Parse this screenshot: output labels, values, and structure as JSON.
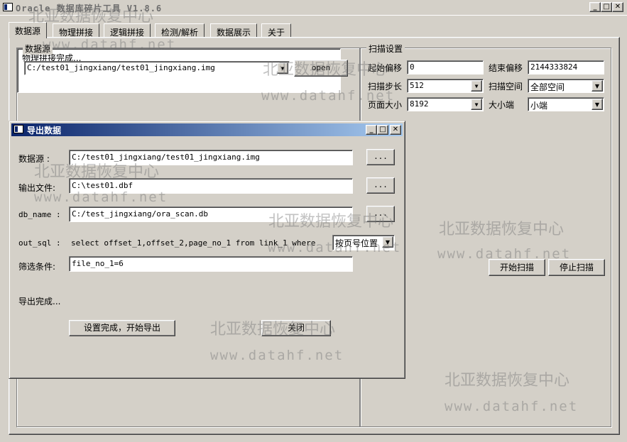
{
  "window": {
    "title": "Oracle 数据库碎片工具  V1.8.6",
    "buttons": {
      "minimize": "_",
      "maximize": "□",
      "close": "✕"
    }
  },
  "tabs": [
    {
      "label": "数据源"
    },
    {
      "label": "物理拼接"
    },
    {
      "label": "逻辑拼接"
    },
    {
      "label": "检测/解析"
    },
    {
      "label": "数据展示"
    },
    {
      "label": "关于"
    }
  ],
  "datasource": {
    "group_title": "数据源",
    "path": "C:/test01_jingxiang/test01_jingxiang.img",
    "open_label": "open"
  },
  "scan": {
    "group_title": "扫描设置",
    "start_offset_label": "起始偏移",
    "start_offset": "0",
    "end_offset_label": "结束偏移",
    "end_offset": "2144333824",
    "step_label": "扫描步长",
    "step": "512",
    "space_label": "扫描空间",
    "space": "全部空间",
    "page_size_label": "页面大小",
    "page_size": "8192",
    "endian_label": "大小端",
    "endian": "小端",
    "start_button": "开始扫描",
    "stop_button": "停止扫描"
  },
  "log": {
    "text": "物理拼接完成..."
  },
  "dialog": {
    "title": "导出数据",
    "datasource_label": "数据源  :",
    "datasource_value": "C:/test01_jingxiang/test01_jingxiang.img",
    "output_label": "输出文件:",
    "output_value": "C:\\test01.dbf",
    "dbname_label": "db_name  :",
    "dbname_value": "C:/test_jingxiang/ora_scan.db",
    "browse_label": "...",
    "sql_label": "out_sql  :",
    "sql_value": "select offset_1,offset_2,page_no_1 from link_1 where",
    "sort_value": "按页号位置",
    "filter_label": "筛选条件:",
    "filter_value": "file_no_1=6",
    "status": "导出完成...",
    "export_button": "设置完成，开始导出",
    "close_button": "关闭"
  },
  "watermarks": {
    "cn": "北亚数据恢复中心",
    "url": "www.datahf.net"
  }
}
